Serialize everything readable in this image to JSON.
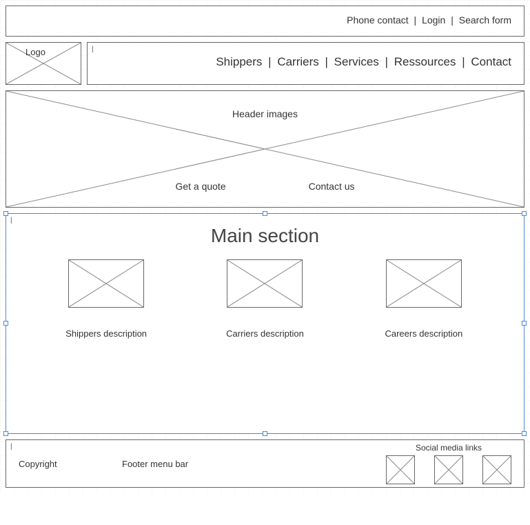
{
  "topbar": {
    "phone": "Phone contact",
    "login": "Login",
    "search": "Search form"
  },
  "logo_label": "Logo",
  "nav": {
    "shippers": "Shippers",
    "carriers": "Carriers",
    "services": "Services",
    "resources": "Ressources",
    "contact": "Contact"
  },
  "header": {
    "label": "Header images",
    "cta_quote": "Get a quote",
    "cta_contact": "Contact us"
  },
  "main": {
    "title": "Main section",
    "cols": [
      {
        "desc": "Shippers description"
      },
      {
        "desc": "Carriers description"
      },
      {
        "desc": "Careers description"
      }
    ]
  },
  "footer": {
    "copyright": "Copyright",
    "menu": "Footer menu bar",
    "social_label": "Social media links"
  }
}
